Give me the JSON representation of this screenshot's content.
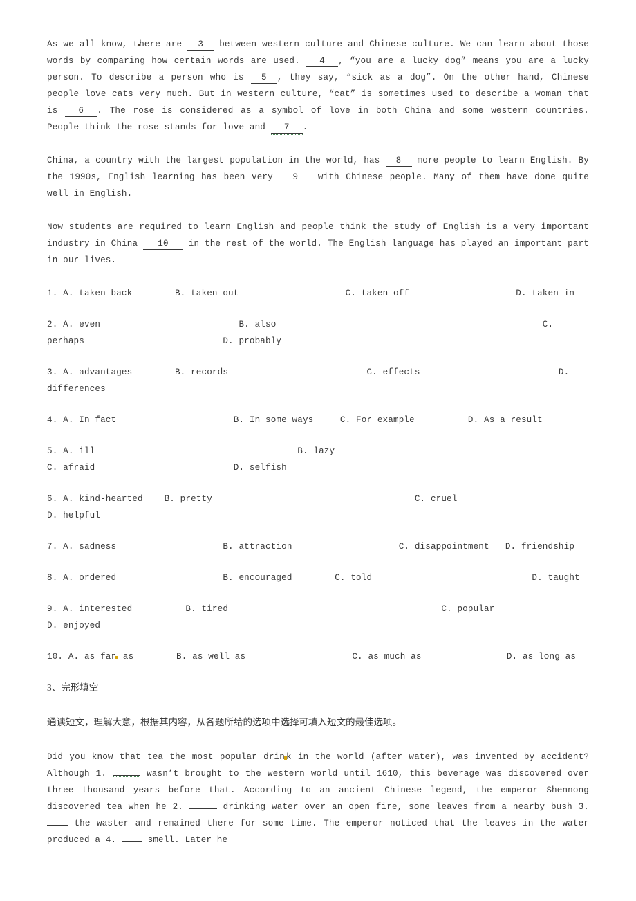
{
  "document": {
    "type": "english-exam-worksheet",
    "page_background": "#ffffff",
    "text_color": "#3a3a3a",
    "proofing_mark_color": "#4c8a58",
    "artifact_color": "#d6a50d"
  },
  "passage": {
    "paragraph1": {
      "seg_a": "As we all know, t",
      "seg_b": "here are ",
      "blank3": "3",
      "seg_c": " between western culture and Chinese culture. We can learn about those words by comparing how certain words are used. ",
      "blank4": "4",
      "seg_d": ", “you are a lucky dog” means you are a lucky person. To describe a person who is ",
      "blank5": "5",
      "seg_e": ", they say, “sick as a dog”. On the other hand, Chinese people love cats very much. But in western culture, “cat” is sometimes used to describe a woman that is ",
      "blank6": "6",
      "seg_f": ". The rose is considered as a symbol of love in both China and some western countries. People think the rose stands for love and ",
      "blank7": "7",
      "seg_g": "."
    },
    "paragraph2": {
      "seg_a": "China, a country with the largest population in the world, has ",
      "blank8": "8",
      "seg_b": " more people to learn English. By the 1990s, English learning has been very ",
      "blank9": "9",
      "seg_c": " with Chinese people. Many of them have done quite well in English."
    },
    "paragraph3": {
      "seg_a": "Now students are required to learn English and people think the study of English is a very important industry in China ",
      "blank10": "10",
      "seg_b": " in the rest of the world. The English language has played an important part in our lives."
    }
  },
  "questions": [
    {
      "number": "1.",
      "line": "1. A. taken back        B. taken out                    C. taken off                    D. taken in"
    },
    {
      "number": "2.",
      "line": "2. A. even                          B. also                                                  C. perhaps                          D. probably"
    },
    {
      "number": "3.",
      "line": "3. A. advantages        B. records                          C. effects                          D. differences"
    },
    {
      "number": "4.",
      "line": "4. A. In fact                      B. In some ways     C. For example          D. As a result"
    },
    {
      "number": "5.",
      "line": "5. A. ill                                      B. lazy                                              C. afraid                          D. selfish"
    },
    {
      "number": "6.",
      "line": "6. A. kind-hearted    B. pretty                                      C. cruel                          D. helpful"
    },
    {
      "number": "7.",
      "line": "7. A. sadness                    B. attraction                    C. disappointment   D. friendship"
    },
    {
      "number": "8.",
      "line": "8. A. ordered                    B. encouraged        C. told                              D. taught"
    },
    {
      "number": "9.",
      "line": "9. A. interested          B. tired                                        C. popular                    D. enjoyed"
    },
    {
      "number": "10.",
      "line_pre": "10. A. as far",
      "line_post": " as        B. as well as                    C. as much as                D. as long as"
    }
  ],
  "chinese_section": {
    "heading": "3、完形填空",
    "instruction": "通读短文，理解大意，根据其内容，从各题所给的选项中选择可填入短文的最佳选项。"
  },
  "cloze_passage": {
    "seg_a": "Did you know that tea the most popular drin",
    "seg_b": "k in the world   (after water), was invented by accident? Although 1. ",
    "blank1": "",
    "seg_c": " wasn’t brought to the western world until 1610, this beverage was discovered over three thousand years before that. According to an ancient Chinese legend, the emperor Shennong discovered tea when he 2. ",
    "blank2": "",
    "seg_d": " drinking water over an open fire, some leaves from a nearby bush 3. ",
    "blank3": "",
    "seg_e": " the waster and remained there for some time. The emperor noticed that the leaves in the water produced a 4. ",
    "blank4": "",
    "seg_f": " smell. Later he"
  }
}
